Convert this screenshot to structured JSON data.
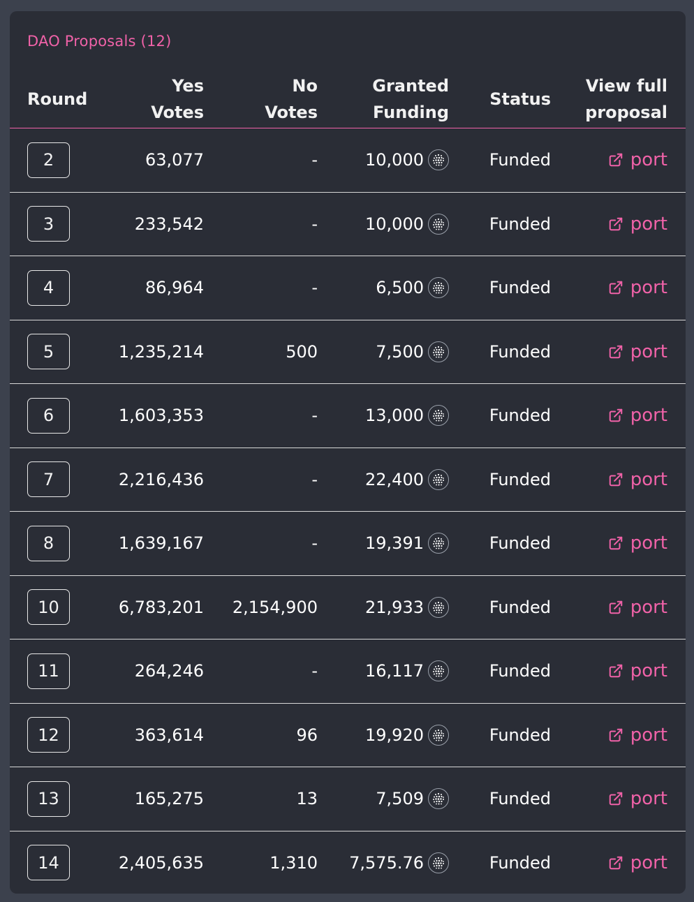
{
  "title": "DAO Proposals (12)",
  "columns": {
    "round": "Round",
    "yes": [
      "Yes",
      "Votes"
    ],
    "no": [
      "No",
      "Votes"
    ],
    "granted": [
      "Granted",
      "Funding"
    ],
    "status": "Status",
    "view": [
      "View full",
      "proposal"
    ]
  },
  "rows": [
    {
      "round": "2",
      "yes": "63,077",
      "no": "-",
      "granted": "10,000",
      "status": "Funded",
      "link": "port"
    },
    {
      "round": "3",
      "yes": "233,542",
      "no": "-",
      "granted": "10,000",
      "status": "Funded",
      "link": "port"
    },
    {
      "round": "4",
      "yes": "86,964",
      "no": "-",
      "granted": "6,500",
      "status": "Funded",
      "link": "port"
    },
    {
      "round": "5",
      "yes": "1,235,214",
      "no": "500",
      "granted": "7,500",
      "status": "Funded",
      "link": "port"
    },
    {
      "round": "6",
      "yes": "1,603,353",
      "no": "-",
      "granted": "13,000",
      "status": "Funded",
      "link": "port"
    },
    {
      "round": "7",
      "yes": "2,216,436",
      "no": "-",
      "granted": "22,400",
      "status": "Funded",
      "link": "port"
    },
    {
      "round": "8",
      "yes": "1,639,167",
      "no": "-",
      "granted": "19,391",
      "status": "Funded",
      "link": "port"
    },
    {
      "round": "10",
      "yes": "6,783,201",
      "no": "2,154,900",
      "granted": "21,933",
      "status": "Funded",
      "link": "port"
    },
    {
      "round": "11",
      "yes": "264,246",
      "no": "-",
      "granted": "16,117",
      "status": "Funded",
      "link": "port"
    },
    {
      "round": "12",
      "yes": "363,614",
      "no": "96",
      "granted": "19,920",
      "status": "Funded",
      "link": "port"
    },
    {
      "round": "13",
      "yes": "165,275",
      "no": "13",
      "granted": "7,509",
      "status": "Funded",
      "link": "port"
    },
    {
      "round": "14",
      "yes": "2,405,635",
      "no": "1,310",
      "granted": "7,575.76",
      "status": "Funded",
      "link": "port"
    }
  ],
  "icons": {
    "token": "ocean-token-icon",
    "link": "external-link-icon"
  },
  "colors": {
    "accent": "#f062a8",
    "card": "#2a2d36",
    "page": "#3c414d"
  }
}
